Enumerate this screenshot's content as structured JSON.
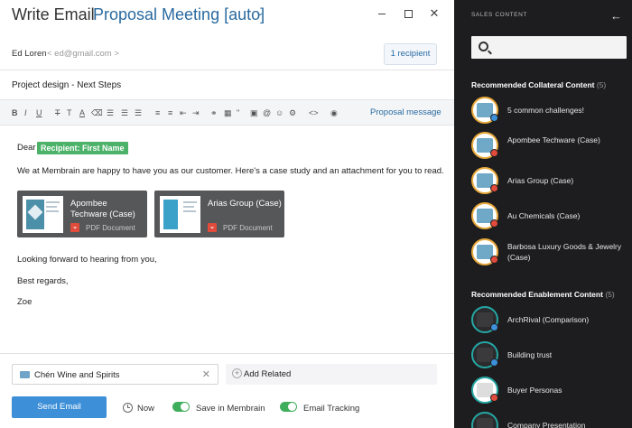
{
  "window": {
    "title": "Write Email",
    "subtitle": "Proposal Meeting [auto]",
    "caret": "⌄",
    "close_glyph": "✕"
  },
  "from": {
    "name": "Ed Loren",
    "email": "< ed@gmail.com >",
    "recipient_button": "1 recipient"
  },
  "subject": "Project design - Next Steps",
  "toolbar": {
    "bold": "B",
    "italic": "I",
    "underline": "U",
    "strike": "T",
    "text_size": "T",
    "font_color": "A",
    "link_glyph": "⚭",
    "quote_glyph": "\"",
    "at_glyph": "@",
    "emoji_glyph": "☺",
    "code_glyph": "<>",
    "eye_glyph": "◉",
    "proposal_link": "Proposal message"
  },
  "body": {
    "greeting": "Dear",
    "recipient_tag": "Recipient: First Name",
    "intro": "We at Membrain are happy to have you as our customer. Here's a case study and an attachment for you to read.",
    "attachments": [
      {
        "name": "Apombee Techware (Case)",
        "type": "PDF Document"
      },
      {
        "name": "Arias Group (Case)",
        "type": "PDF Document"
      }
    ],
    "closing": "Looking forward to hearing from you,",
    "sign_off": "Best regards,",
    "signature": "Zoe"
  },
  "footer": {
    "company": "Chén Wine and Spirits",
    "company_clear": "✕",
    "add_related": "Add Related",
    "add_glyph": "+",
    "send_button": "Send Email",
    "schedule": "Now",
    "save_label": "Save in Membrain",
    "tracking_label": "Email Tracking",
    "save_enabled": true,
    "tracking_enabled": true
  },
  "sidebar": {
    "heading": "SALES CONTENT",
    "back_glyph": "←",
    "sections": [
      {
        "title": "Recommended Collateral Content",
        "count": "(5)",
        "items": [
          {
            "label": "5 common challenges!",
            "icon": "document-thumbnail",
            "badge": "blue"
          },
          {
            "label": "Apombee Techware (Case)",
            "icon": "document-thumbnail",
            "badge": "red"
          },
          {
            "label": "Arias Group (Case)",
            "icon": "document-thumbnail",
            "badge": "red"
          },
          {
            "label": "Au Chemicals (Case)",
            "icon": "document-thumbnail",
            "badge": "red"
          },
          {
            "label": "Barbosa Luxury Goods & Jewelry (Case)",
            "icon": "document-thumbnail",
            "badge": "red"
          }
        ]
      },
      {
        "title": "Recommended Enablement Content",
        "count": "(5)",
        "items": [
          {
            "label": "ArchRival (Comparison)",
            "icon": "document-thumbnail",
            "badge": "blue"
          },
          {
            "label": "Building trust",
            "icon": "document-thumbnail",
            "badge": "blue"
          },
          {
            "label": "Buyer Personas",
            "icon": "document-thumbnail",
            "badge": "red"
          },
          {
            "label": "Company Presentation",
            "icon": "document-thumbnail",
            "badge": "blue"
          }
        ]
      }
    ]
  },
  "colors": {
    "accent": "#2a6aa0",
    "send_button": "#3d8fd8",
    "tag_green": "#4cb26a",
    "toggle_green": "#3fae5c",
    "sidebar_bg": "#1d1d1f",
    "collateral_ring": "#e8a93c",
    "enablement_ring": "#25a7a4",
    "pdf_red": "#e04b3c"
  }
}
